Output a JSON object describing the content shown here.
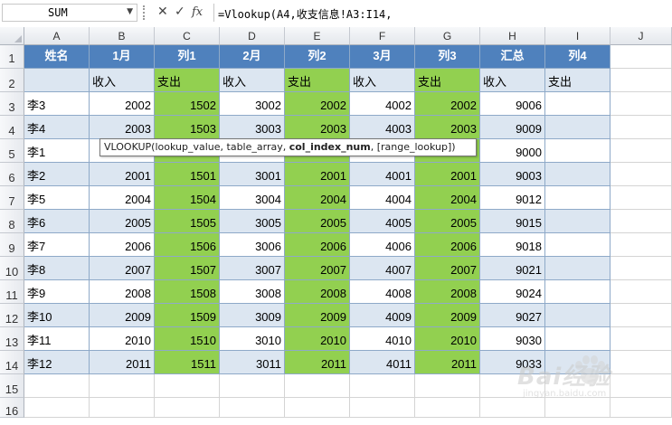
{
  "formula_bar": {
    "name_box": "SUM",
    "cancel_glyph": "✕",
    "enter_glyph": "✓",
    "fx_label": "fx",
    "formula": "=Vlookup(A4,收支信息!A3:I14,"
  },
  "columns": [
    "A",
    "B",
    "C",
    "D",
    "E",
    "F",
    "G",
    "H",
    "I",
    "J"
  ],
  "rows": [
    "1",
    "2",
    "3",
    "4",
    "5",
    "6",
    "7",
    "8",
    "9",
    "10",
    "11",
    "12",
    "13",
    "14",
    "15",
    "16"
  ],
  "header_row": [
    "姓名",
    "1月",
    "列1",
    "2月",
    "列2",
    "3月",
    "列3",
    "汇总",
    "列4"
  ],
  "subheader_row": [
    "",
    "收入",
    "支出",
    "收入",
    "支出",
    "收入",
    "支出",
    "收入",
    "支出"
  ],
  "data_rows": [
    [
      "李3",
      "2002",
      "1502",
      "3002",
      "2002",
      "4002",
      "2002",
      "9006",
      ""
    ],
    [
      "李4",
      "2003",
      "1503",
      "3003",
      "2003",
      "4003",
      "2003",
      "9009",
      ""
    ],
    [
      "李1",
      "",
      "",
      "",
      "",
      "",
      "",
      "9000",
      ""
    ],
    [
      "李2",
      "2001",
      "1501",
      "3001",
      "2001",
      "4001",
      "2001",
      "9003",
      ""
    ],
    [
      "李5",
      "2004",
      "1504",
      "3004",
      "2004",
      "4004",
      "2004",
      "9012",
      ""
    ],
    [
      "李6",
      "2005",
      "1505",
      "3005",
      "2005",
      "4005",
      "2005",
      "9015",
      ""
    ],
    [
      "李7",
      "2006",
      "1506",
      "3006",
      "2006",
      "4006",
      "2006",
      "9018",
      ""
    ],
    [
      "李8",
      "2007",
      "1507",
      "3007",
      "2007",
      "4007",
      "2007",
      "9021",
      ""
    ],
    [
      "李9",
      "2008",
      "1508",
      "3008",
      "2008",
      "4008",
      "2008",
      "9024",
      ""
    ],
    [
      "李10",
      "2009",
      "1509",
      "3009",
      "2009",
      "4009",
      "2009",
      "9027",
      ""
    ],
    [
      "李11",
      "2010",
      "1510",
      "3010",
      "2010",
      "4010",
      "2010",
      "9030",
      ""
    ],
    [
      "李12",
      "2011",
      "1511",
      "3011",
      "2011",
      "4011",
      "2011",
      "9033",
      ""
    ]
  ],
  "tooltip": {
    "prefix": "VLOOKUP(lookup_value, table_array, ",
    "bold": "col_index_num",
    "suffix": ", [range_lookup])"
  },
  "watermark": {
    "text": "Bai经验",
    "sub": "jingyan.baidu.com"
  },
  "colors": {
    "header_blue": "#4f81bd",
    "band_blue": "#dce6f1",
    "green": "#92d050"
  }
}
